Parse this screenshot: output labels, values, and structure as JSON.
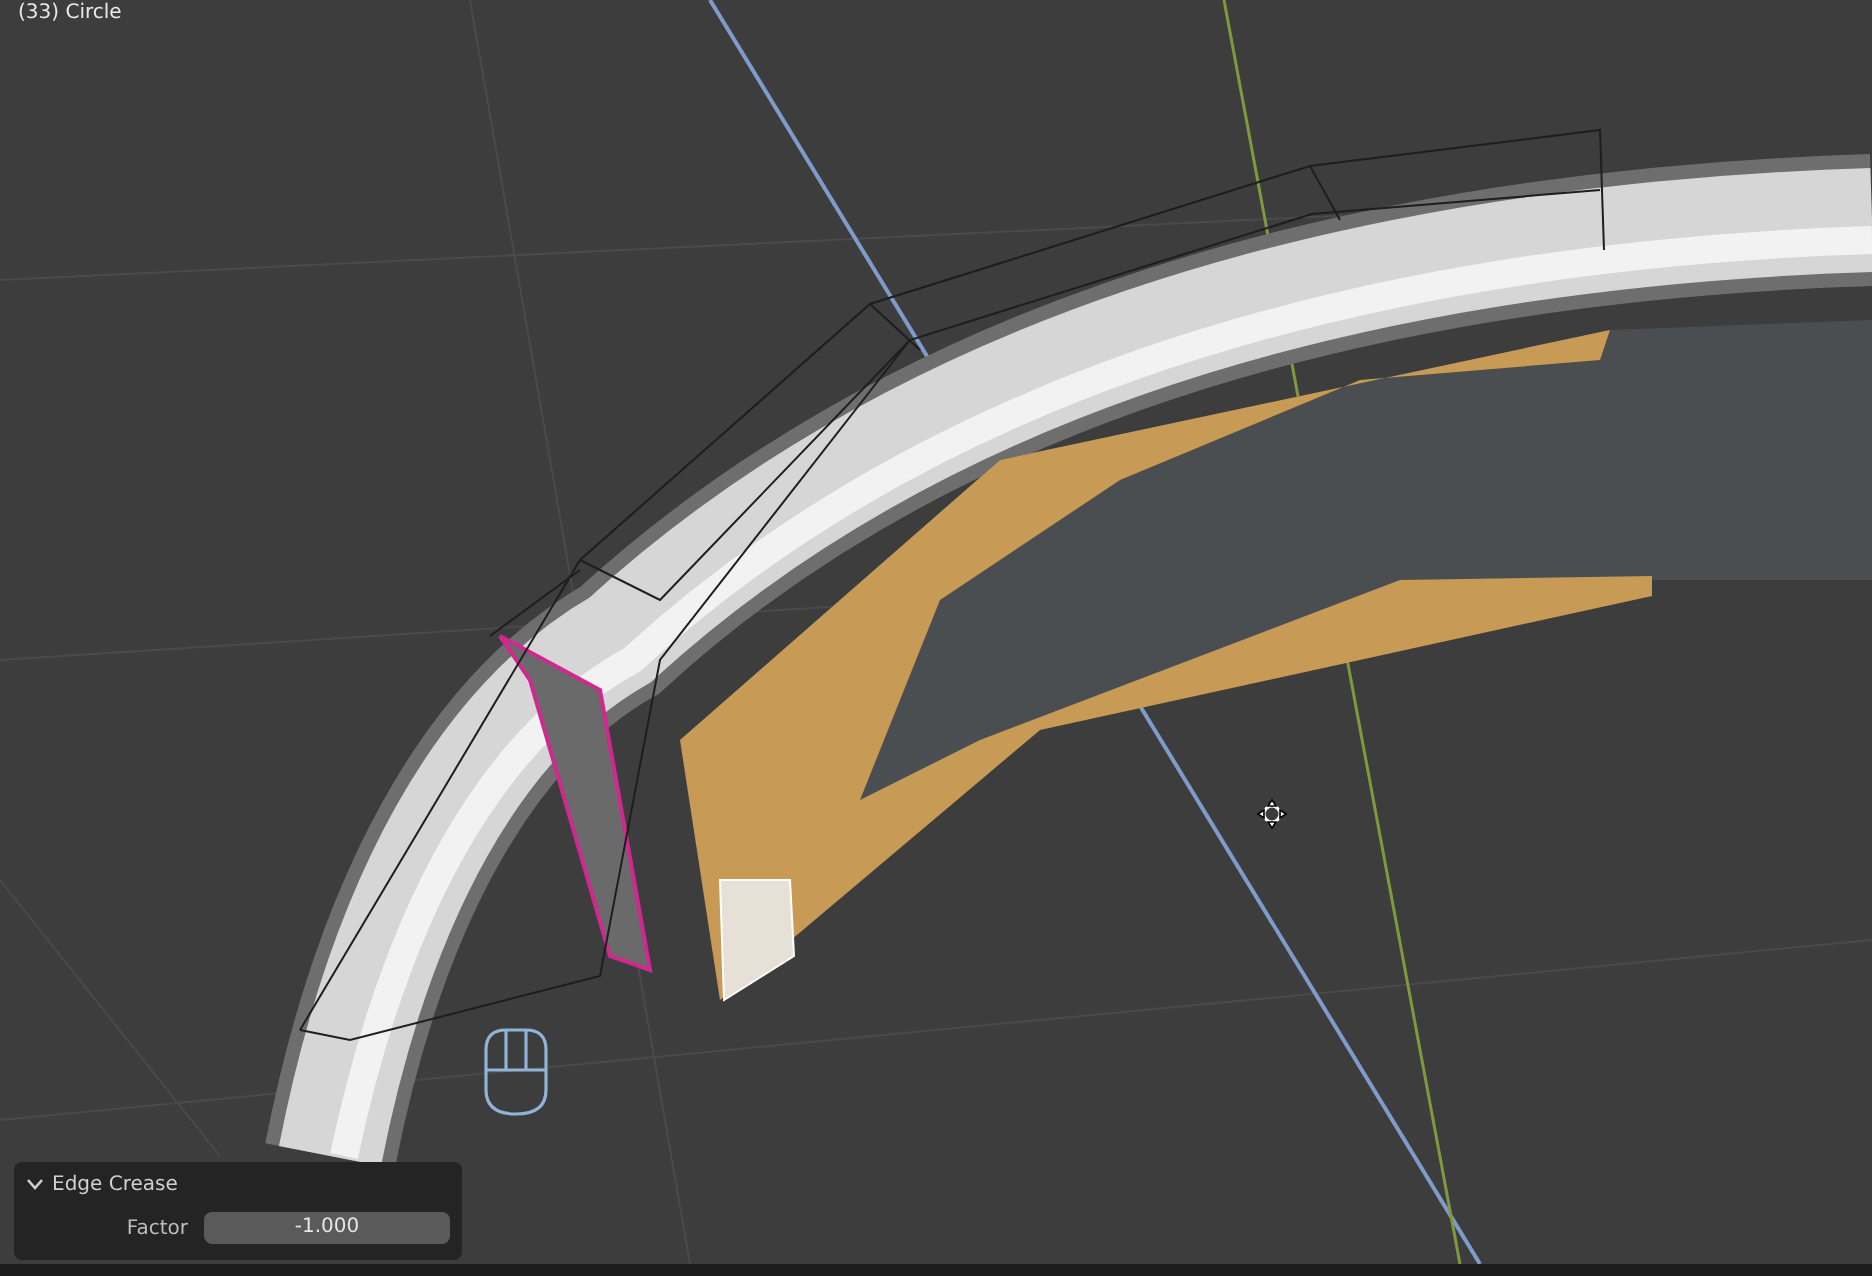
{
  "viewport": {
    "object_label": "(33) Circle"
  },
  "operator_panel": {
    "title": "Edge Crease",
    "expanded": true,
    "fields": [
      {
        "label": "Factor",
        "value": "-1.000"
      }
    ]
  }
}
